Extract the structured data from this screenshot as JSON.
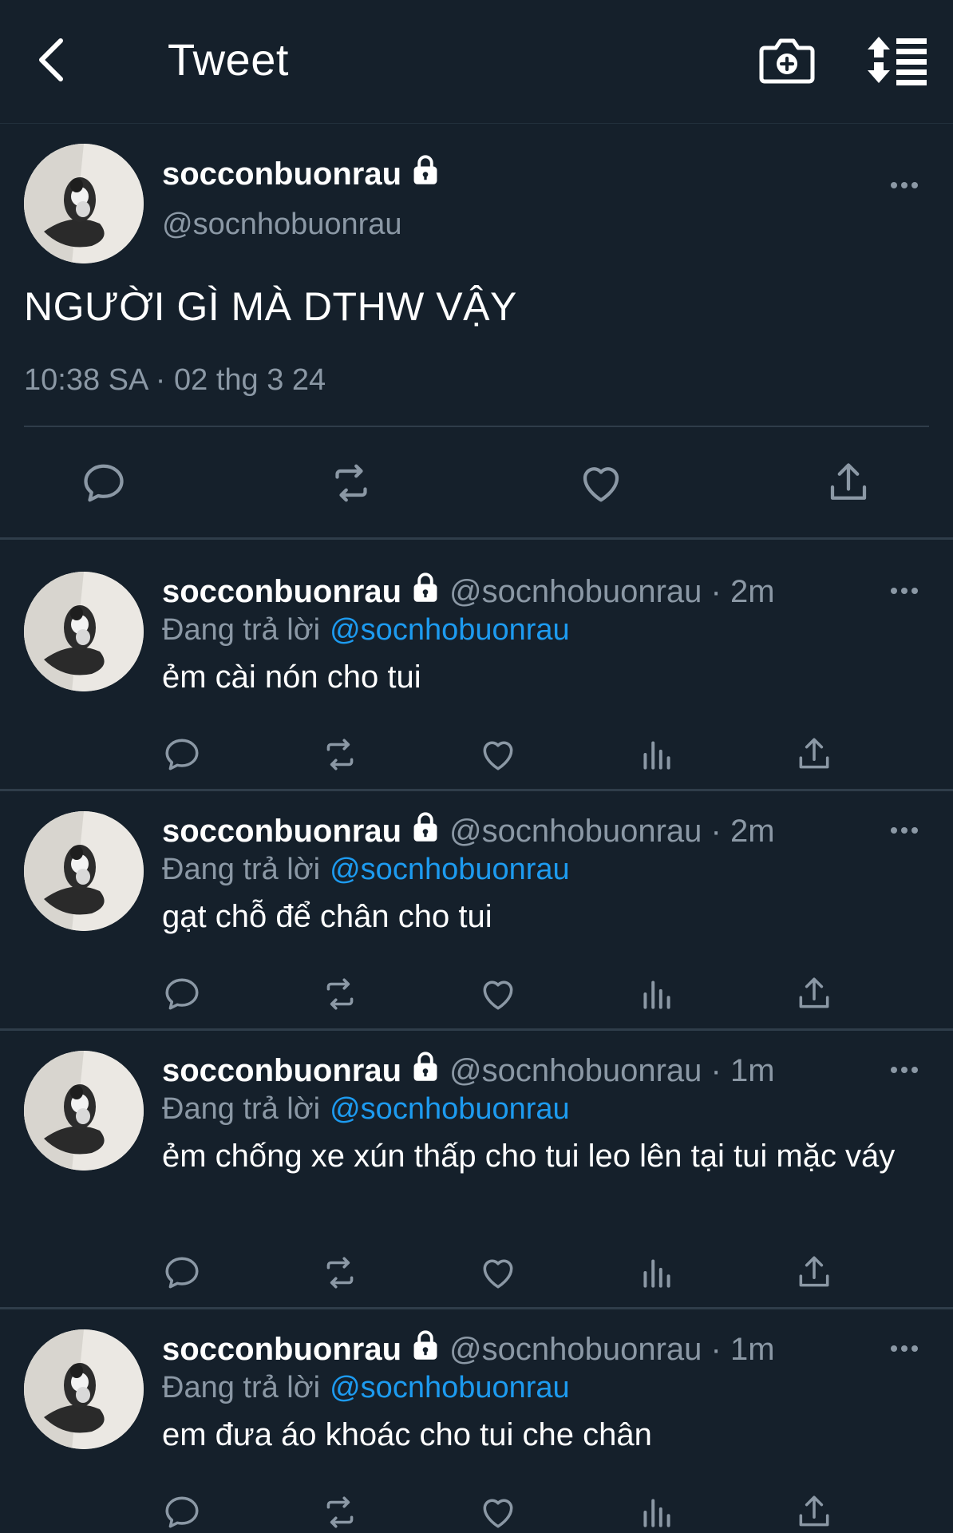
{
  "header": {
    "title": "Tweet",
    "back_icon": "chevron-left-icon",
    "camera_icon": "camera-add-icon",
    "sort_icon": "sort-icon"
  },
  "colors": {
    "background": "#15202b",
    "divider": "#2f3d4a",
    "secondary_text": "#8b98a5",
    "accent": "#1d9bf0"
  },
  "main_tweet": {
    "display_name": "socconbuonrau",
    "handle": "@socnhobuonrau",
    "text": "NGƯỜI GÌ MÀ DTHW VẬY",
    "timestamp": "10:38 SA · 02 thg 3 24",
    "actions": [
      "reply-icon",
      "retweet-icon",
      "like-icon",
      "share-icon"
    ]
  },
  "replies": [
    {
      "display_name": "socconbuonrau",
      "handle_time": "@socnhobuonrau · 2m",
      "replying_to_label": "Đang trả lời",
      "replying_to_handle": "@socnhobuonrau",
      "text": "ẻm cài nón cho tui"
    },
    {
      "display_name": "socconbuonrau",
      "handle_time": "@socnhobuonrau · 2m",
      "replying_to_label": "Đang trả lời",
      "replying_to_handle": "@socnhobuonrau",
      "text": "gạt chỗ để chân cho tui"
    },
    {
      "display_name": "socconbuonrau",
      "handle_time": "@socnhobuonrau · 1m",
      "replying_to_label": "Đang trả lời",
      "replying_to_handle": "@socnhobuonrau",
      "text": "ẻm chống xe xún thấp cho tui leo lên tại tui mặc váy"
    },
    {
      "display_name": "socconbuonrau",
      "handle_time": "@socnhobuonrau · 1m",
      "replying_to_label": "Đang trả lời",
      "replying_to_handle": "@socnhobuonrau",
      "text": "em đưa áo khoác cho tui che chân"
    }
  ]
}
